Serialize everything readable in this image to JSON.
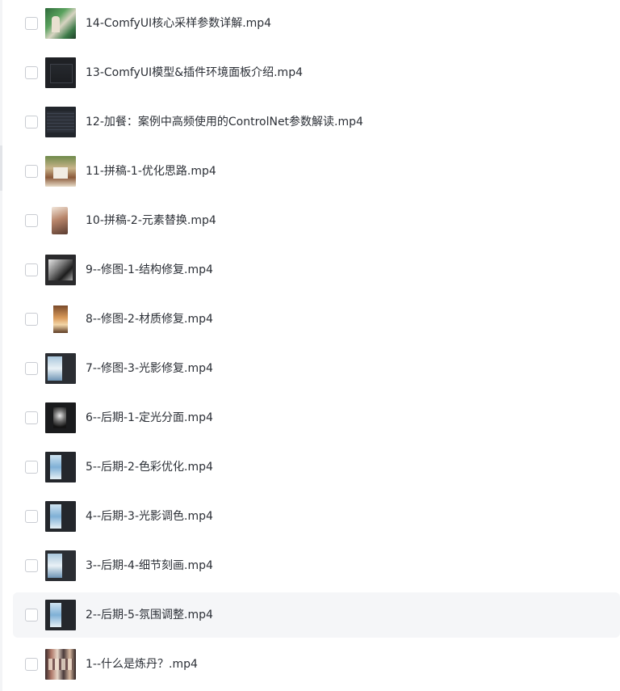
{
  "files": [
    {
      "name": "14-ComfyUI核心采样参数详解.mp4",
      "thumbnail": "green-scene-thumbnail",
      "checked": false
    },
    {
      "name": "13-ComfyUI模型&插件环境面板介绍.mp4",
      "thumbnail": "dark-ui-thumbnail",
      "checked": false
    },
    {
      "name": "12-加餐：案例中高频使用的ControlNet参数解读.mp4",
      "thumbnail": "dark-ui-thumbnail",
      "checked": false
    },
    {
      "name": "11-拼稿-1-优化思路.mp4",
      "thumbnail": "room-scene-thumbnail",
      "checked": false
    },
    {
      "name": "10-拼稿-2-元素替换.mp4",
      "thumbnail": "figure-thumbnail",
      "checked": false
    },
    {
      "name": "9--修图-1-结构修复.mp4",
      "thumbnail": "structure-thumbnail",
      "checked": false
    },
    {
      "name": "8--修图-2-材质修复.mp4",
      "thumbnail": "material-thumbnail",
      "checked": false
    },
    {
      "name": "7--修图-3-光影修复.mp4",
      "thumbnail": "photo-edit-thumbnail",
      "checked": false
    },
    {
      "name": "6--后期-1-定光分面.mp4",
      "thumbnail": "night-thumbnail",
      "checked": false
    },
    {
      "name": "5--后期-2-色彩优化.mp4",
      "thumbnail": "blue-photo-thumbnail",
      "checked": false
    },
    {
      "name": "4--后期-3-光影调色.mp4",
      "thumbnail": "blue-photo-thumbnail",
      "checked": false
    },
    {
      "name": "3--后期-4-细节刻画.mp4",
      "thumbnail": "photo-edit-thumbnail",
      "checked": false
    },
    {
      "name": "2--后期-5-氛围调整.mp4",
      "thumbnail": "blue-photo-thumbnail",
      "checked": false,
      "hovered": true
    },
    {
      "name": "1--什么是炼丹？.mp4",
      "thumbnail": "collage-thumbnail",
      "checked": false
    }
  ],
  "colors": {
    "text": "#2b2f36",
    "checkbox_border": "#c9ccd2",
    "row_hover": "#f5f6f8"
  }
}
